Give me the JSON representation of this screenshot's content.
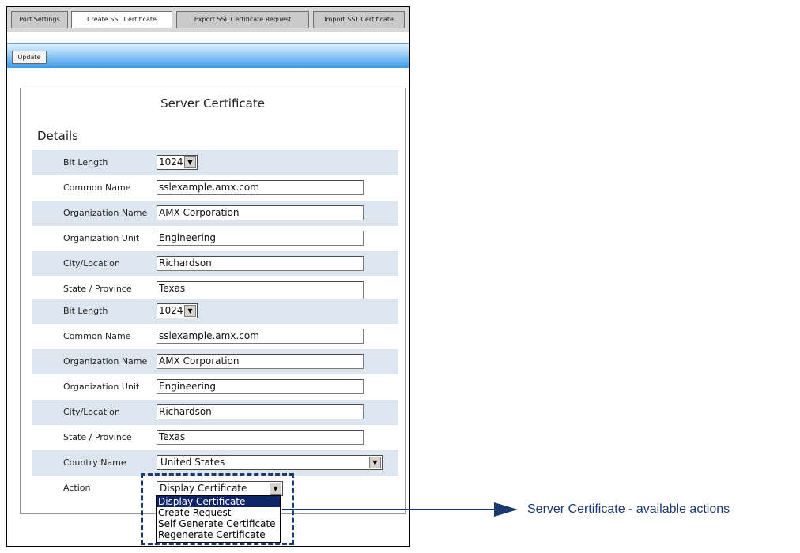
{
  "tabs": [
    {
      "label": "Port Settings",
      "active": false
    },
    {
      "label": "Create SSL Certificate",
      "active": true
    },
    {
      "label": "Export SSL Certificate Request",
      "active": false
    },
    {
      "label": "Import SSL Certificate",
      "active": false
    }
  ],
  "toolbar": {
    "update_label": "Update"
  },
  "panel": {
    "title": "Server Certificate",
    "section": "Details"
  },
  "form": {
    "bit_length_label": "Bit Length",
    "bit_length_value": "1024",
    "common_name_label": "Common Name",
    "common_name_value": "sslexample.amx.com",
    "organization_name_label": "Organization Name",
    "organization_name_value": "AMX Corporation",
    "organization_unit_label": "Organization Unit",
    "organization_unit_value": "Engineering",
    "city_label": "City/Location",
    "city_value": "Richardson",
    "state_label": "State / Province",
    "state_value": "Texas",
    "country_label": "Country Name",
    "country_value": "United States",
    "action_label": "Action",
    "action_value": "Display Certificate"
  },
  "action_options": [
    "Display Certificate",
    "Create Request",
    "Self Generate Certificate",
    "Regenerate Certificate"
  ],
  "callout": {
    "text": "Server Certificate - available actions"
  },
  "icons": {
    "dropdown": "chevron-down-icon",
    "callout": "arrow-left-icon"
  },
  "colors": {
    "row_shade": "#dde6ef",
    "toolbar_blue": "#3c99e8",
    "selected_option": "#10246a",
    "callout": "#1a3a70"
  }
}
